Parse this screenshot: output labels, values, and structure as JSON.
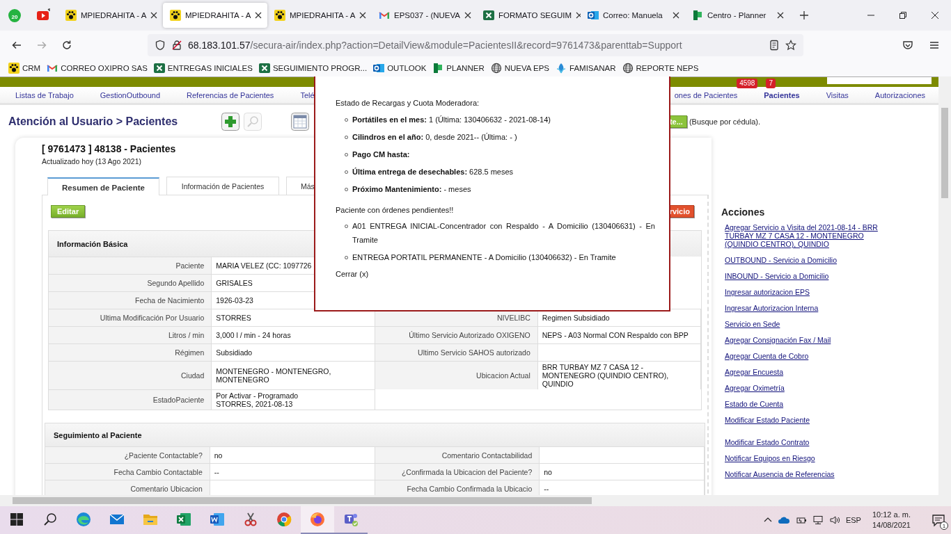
{
  "browser": {
    "pinned": [
      {
        "kind": "whatsapp",
        "badge": "20"
      },
      {
        "kind": "youtube"
      }
    ],
    "tabs": [
      {
        "title": "MPIEDRAHITA - A",
        "kind": "paw",
        "selected": false
      },
      {
        "title": "MPIEDRAHITA - A",
        "kind": "paw",
        "selected": true
      },
      {
        "title": "MPIEDRAHITA - A",
        "kind": "paw",
        "selected": false
      },
      {
        "title": "EPS037 - (NUEVA",
        "kind": "gmail",
        "selected": false
      },
      {
        "title": "FORMATO SEGUIM",
        "kind": "excel",
        "selected": false
      },
      {
        "title": "Correo: Manuela",
        "kind": "outlook",
        "selected": false
      },
      {
        "title": "Centro - Planner",
        "kind": "planner",
        "selected": false
      }
    ],
    "url": {
      "host": "68.183.101.57",
      "path": "/secura-air/index.php?action=DetailView&module=PacientesII&record=9761473&parenttab=Support"
    },
    "bookmarks": [
      {
        "label": "CRM",
        "kind": "paw"
      },
      {
        "label": "CORREO OXIPRO SAS",
        "kind": "gmail"
      },
      {
        "label": "ENTREGAS INICIALES",
        "kind": "excel"
      },
      {
        "label": "SEGUIMIENTO PROGR...",
        "kind": "excel"
      },
      {
        "label": "OUTLOOK",
        "kind": "outlook"
      },
      {
        "label": "PLANNER",
        "kind": "planner"
      },
      {
        "label": "NUEVA EPS",
        "kind": "globe"
      },
      {
        "label": "FAMISANAR",
        "kind": "leaf"
      },
      {
        "label": "REPORTE NEPS",
        "kind": "globe"
      }
    ]
  },
  "app": {
    "header_badges": [
      "4598",
      "7"
    ],
    "nav_left": [
      {
        "label": "Listas de Trabajo",
        "selected": false
      },
      {
        "label": "GestionOutbound",
        "selected": false
      },
      {
        "label": "Referencias de Pacientes",
        "selected": false
      },
      {
        "label": "Telé",
        "selected": false
      }
    ],
    "nav_right": [
      {
        "label": "ones de Pacientes",
        "selected": false
      },
      {
        "label": "Pacientes",
        "selected": true
      },
      {
        "label": "Visitas",
        "selected": false
      },
      {
        "label": "Autorizaciones",
        "selected": false
      }
    ],
    "page_title": "Atención al Usuario > Pacientes",
    "search_button": "te...",
    "search_hint": "(Busque por cédula).",
    "record_title": "[ 9761473 ] 48138 - Pacientes",
    "record_updated": "Actualizado hoy (13 Ago 2021)",
    "tabs": [
      {
        "label": "Resumen de Paciente",
        "selected": true
      },
      {
        "label": "Información de Pacientes",
        "selected": false
      },
      {
        "label": "Más",
        "selected": false
      }
    ],
    "edit_button": "Editar",
    "service_button": "rvicio",
    "sections": [
      {
        "title": "Información Básica",
        "rows": [
          {
            "left": {
              "label": "Paciente",
              "value": "MARIA VELEZ (CC: 1097726"
            }
          },
          {
            "left": {
              "label": "Segundo Apellido",
              "value": "GRISALES"
            }
          },
          {
            "left": {
              "label": "Fecha de Nacimiento",
              "value": "1926-03-23"
            }
          },
          {
            "left": {
              "label": "Ultima Modificación Por Usuario",
              "value": "STORRES"
            },
            "right": {
              "label": "NIVELIBC",
              "value": "Regimen Subsidiado"
            }
          },
          {
            "left": {
              "label": "Litros / min",
              "value": "3,000 l / min - 24 horas"
            },
            "right": {
              "label": "Último Servicio Autorizado OXIGENO",
              "value": "NEPS - A03 Normal CON Respaldo con BPP"
            }
          },
          {
            "left": {
              "label": "Régimen",
              "value": "Subsidiado"
            },
            "right": {
              "label": "Ultimo Servicio SAHOS autorizado"
            }
          },
          {
            "left": {
              "label": "Ciudad",
              "value": "MONTENEGRO - MONTENEGRO, MONTENEGRO"
            },
            "right": {
              "label": "Ubicacion Actual",
              "value": "BRR TURBAY MZ 7 CASA 12 - MONTENEGRO (QUINDIO CENTRO), QUINDIO"
            }
          },
          {
            "left": {
              "label": "EstadoPaciente",
              "value": "Por Activar - Programado\nSTORRES, 2021-08-13"
            }
          }
        ]
      },
      {
        "title": "Seguimiento al Paciente",
        "rows": [
          {
            "left": {
              "label": "¿Paciente Contactable?",
              "value": "no"
            },
            "right": {
              "label": "Comentario Contactabilidad"
            }
          },
          {
            "left": {
              "label": "Fecha Cambio Contactable",
              "value": "--"
            },
            "right": {
              "label": "¿Confirmada la Ubicacion del Paciente?",
              "value": "no"
            }
          },
          {
            "left": {
              "label": "Comentario Ubicacion"
            },
            "right": {
              "label": "Fecha Cambio Confirmada la Ubicacio",
              "value": "--"
            }
          }
        ]
      }
    ],
    "actions_title": "Acciones",
    "action_groups": [
      {
        "links": [
          "Agregar Servicio a Visita del 2021-08-14 - BRR TURBAY MZ 7 CASA 12 - MONTENEGRO (QUINDIO CENTRO), QUINDIO",
          "OUTBOUND - Servicio a Domicilio",
          "INBOUND - Servicio a Domicilio",
          "Ingresar autorizacion EPS",
          "Ingresar Autorizacion Interna",
          "Servicio en Sede",
          "Agregar Consignación Fax / Mail",
          "Agregar Cuenta de Cobro",
          "Agregar Encuesta",
          "Agregar Oximetría",
          "Estado de Cuenta",
          "Modificar Estado Paciente"
        ]
      },
      {
        "links": [
          "Modificar Estado Contrato",
          "Notificar Equipos en Riesgo",
          "Notificar Ausencia de Referencias"
        ]
      }
    ]
  },
  "popup": {
    "heading": "Estado de Recargas y Cuota Moderadora:",
    "items": [
      {
        "label": "Portátiles en el mes:",
        "value": "1 (Última: 130406632 - 2021-08-14)"
      },
      {
        "label": "Cilindros en el año:",
        "value": "0, desde 2021-- (Última: - )"
      },
      {
        "label": "Pago CM hasta:"
      },
      {
        "label": "Última entrega de desechables:",
        "value": "628.5 meses"
      },
      {
        "label": "Próximo Mantenimiento:",
        "value": "- meses"
      }
    ],
    "orders_heading": "Paciente con órdenes pendientes!!",
    "orders": [
      "A01 ENTREGA INICIAL-Concentrador con Respaldo - A Domicilio (130406631) - En Tramite",
      "ENTREGA PORTATIL PERMANENTE - A Domicilio (130406632) - En Tramite"
    ],
    "close": "Cerrar (x)"
  },
  "taskbar": {
    "apps": [
      {
        "kind": "start",
        "selected": false,
        "running": false
      },
      {
        "kind": "search",
        "selected": false,
        "running": false
      },
      {
        "kind": "edge",
        "selected": false,
        "running": false
      },
      {
        "kind": "mail",
        "selected": false,
        "running": false
      },
      {
        "kind": "folder",
        "selected": false,
        "running": false
      },
      {
        "kind": "excel",
        "selected": false,
        "running": false
      },
      {
        "kind": "word",
        "selected": false,
        "running": false
      },
      {
        "kind": "snip",
        "selected": false,
        "running": false
      },
      {
        "kind": "chrome",
        "selected": false,
        "running": false
      },
      {
        "kind": "firefox",
        "selected": true,
        "running": true
      },
      {
        "kind": "teams",
        "selected": false,
        "running": true
      }
    ],
    "language": "ESP",
    "time": "10:12 a. m.",
    "date": "14/08/2021",
    "notifications": "1"
  }
}
